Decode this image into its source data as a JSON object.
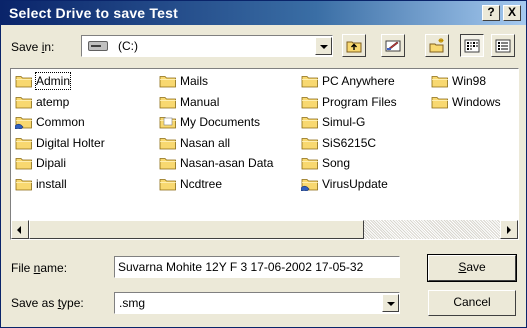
{
  "window": {
    "title": "Select Drive to save Test",
    "help_label": "?",
    "close_label": "X"
  },
  "toolbar": {
    "save_in_label_pre": "Save ",
    "save_in_label_key": "i",
    "save_in_label_post": "n:",
    "save_in_value": "(C:)",
    "buttons": [
      "up-one-level",
      "desktop",
      "create-new-folder",
      "list-view",
      "details-view"
    ]
  },
  "files": [
    {
      "name": "Admin",
      "icon": "folder-icon"
    },
    {
      "name": "atemp",
      "icon": "folder-icon"
    },
    {
      "name": "Common",
      "icon": "shared-folder-icon"
    },
    {
      "name": "Digital Holter",
      "icon": "folder-icon"
    },
    {
      "name": "Dipali",
      "icon": "folder-icon"
    },
    {
      "name": "install",
      "icon": "folder-icon"
    },
    {
      "name": "Mails",
      "icon": "folder-icon"
    },
    {
      "name": "Manual",
      "icon": "folder-icon"
    },
    {
      "name": "My Documents",
      "icon": "documents-folder-icon"
    },
    {
      "name": "Nasan all",
      "icon": "folder-icon"
    },
    {
      "name": "Nasan-asan Data",
      "icon": "folder-icon"
    },
    {
      "name": "Ncdtree",
      "icon": "folder-icon"
    },
    {
      "name": "PC Anywhere",
      "icon": "folder-icon"
    },
    {
      "name": "Program Files",
      "icon": "folder-icon"
    },
    {
      "name": "Simul-G",
      "icon": "folder-icon"
    },
    {
      "name": "SiS6215C",
      "icon": "folder-icon"
    },
    {
      "name": "Song",
      "icon": "folder-icon"
    },
    {
      "name": "VirusUpdate",
      "icon": "shared-folder-icon"
    },
    {
      "name": "Win98",
      "icon": "folder-icon"
    },
    {
      "name": "Windows",
      "icon": "folder-icon"
    }
  ],
  "form": {
    "file_name_label_pre": "File ",
    "file_name_label_key": "n",
    "file_name_label_post": "ame:",
    "file_name_value": "Suvarna Mohite 12Y F 3 17-06-2002 17-05-32",
    "save_as_type_label_pre": "Save as ",
    "save_as_type_label_key": "t",
    "save_as_type_label_post": "ype:",
    "save_as_type_value": ".smg",
    "save_key": "S",
    "save_rest": "ave",
    "cancel_label": "Cancel"
  },
  "colors": {
    "title_gradient_start": "#0a246a",
    "title_gradient_end": "#a6caf0",
    "dialog_face": "#ece9d8",
    "folder_yellow": "#f8d870"
  }
}
